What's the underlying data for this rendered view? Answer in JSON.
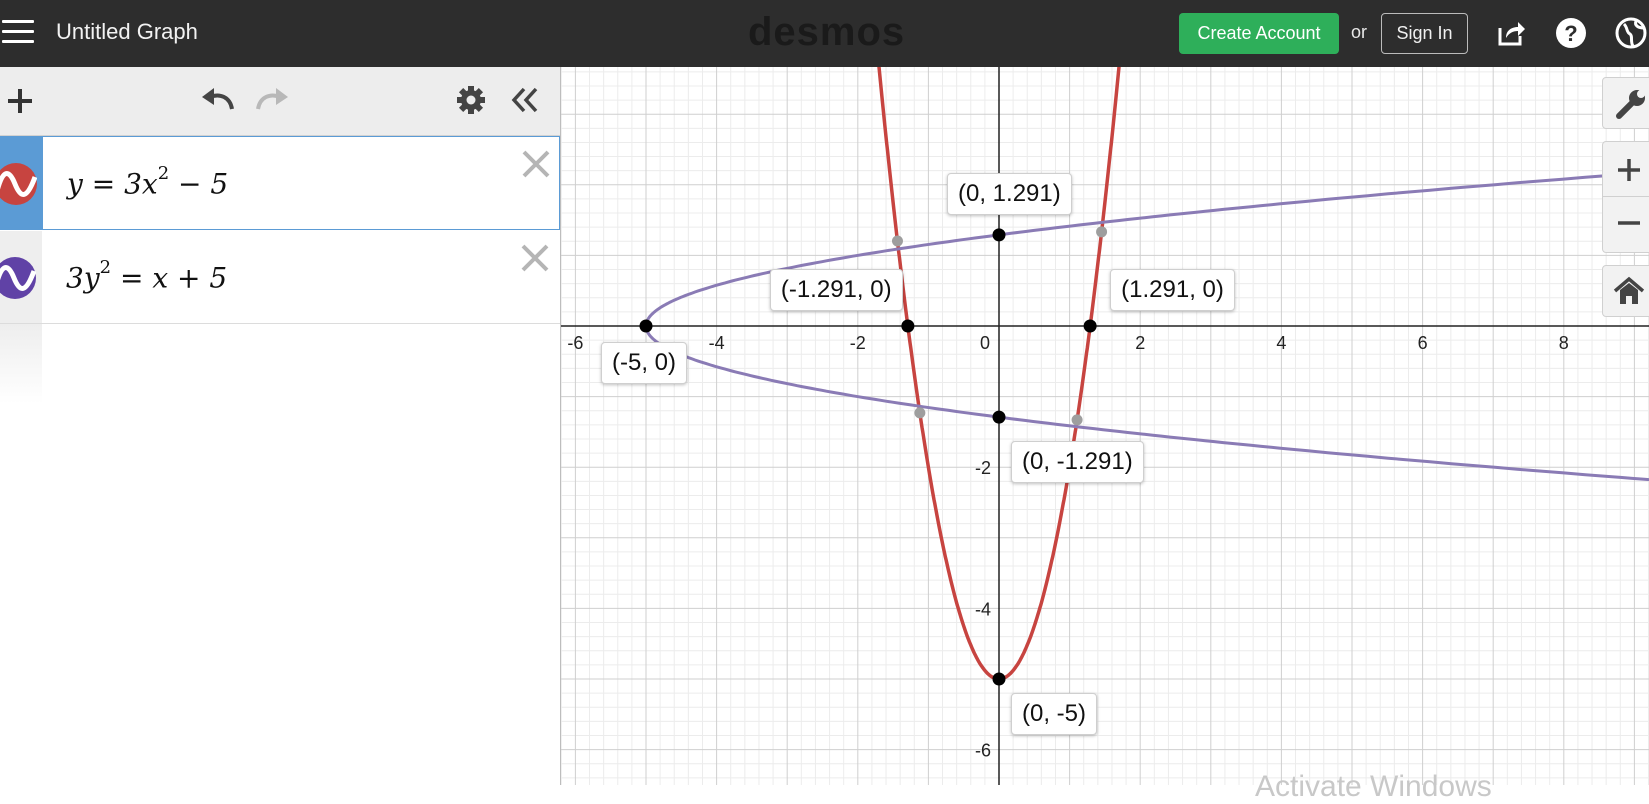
{
  "app": {
    "title": "Untitled Graph",
    "logo": "desmos"
  },
  "header": {
    "create_account": "Create Account",
    "or": "or",
    "sign_in": "Sign In",
    "icons": [
      "menu-icon",
      "share-icon",
      "help-icon",
      "globe-icon"
    ]
  },
  "toolbar": {
    "icons": [
      "add-icon",
      "undo-icon",
      "redo-icon",
      "settings-icon",
      "collapse-panel-icon"
    ]
  },
  "expressions": [
    {
      "latex": "y = 3x^2 − 5",
      "lhs": "y",
      "eq": " = 3x",
      "exp": "2",
      "rest": " − 5",
      "color": "#c74440"
    },
    {
      "latex": "3y^2 = x + 5",
      "lhs": "3y",
      "exp": "2",
      "rest": " = x + 5",
      "color": "#6042a6"
    }
  ],
  "graph_controls": [
    "wrench-icon",
    "zoom-in-icon",
    "zoom-out-icon",
    "home-icon"
  ],
  "watermark": "Activate Windows",
  "chart_data": {
    "type": "line",
    "xlim": [
      -6.2,
      9.3
    ],
    "ylim": [
      -6.3,
      3.9
    ],
    "grid": true,
    "x_ticks": [
      "-6",
      "-4",
      "-2",
      "0",
      "2",
      "4",
      "6",
      "8"
    ],
    "y_ticks": [
      "-2",
      "-4",
      "-6"
    ],
    "series": [
      {
        "equation": "y=3x^2-5",
        "color": "#c74440"
      },
      {
        "equation": "3y^2=x+5",
        "color": "#8a7bb5"
      }
    ],
    "points": [
      {
        "x": 0,
        "y": 1.291,
        "label": "(0, 1.291)"
      },
      {
        "x": -1.291,
        "y": 0,
        "label": "(-1.291, 0)"
      },
      {
        "x": 1.291,
        "y": 0,
        "label": "(1.291, 0)"
      },
      {
        "x": -5,
        "y": 0,
        "label": "(-5, 0)"
      },
      {
        "x": 0,
        "y": -1.291,
        "label": "(0, -1.291)"
      },
      {
        "x": 0,
        "y": -5,
        "label": "(0, -5)"
      }
    ],
    "intersections": [
      {
        "x": -1.438,
        "y": 1.204
      },
      {
        "x": 1.453,
        "y": 1.334
      },
      {
        "x": -1.121,
        "y": -1.23
      },
      {
        "x": 1.106,
        "y": -1.33
      }
    ]
  }
}
